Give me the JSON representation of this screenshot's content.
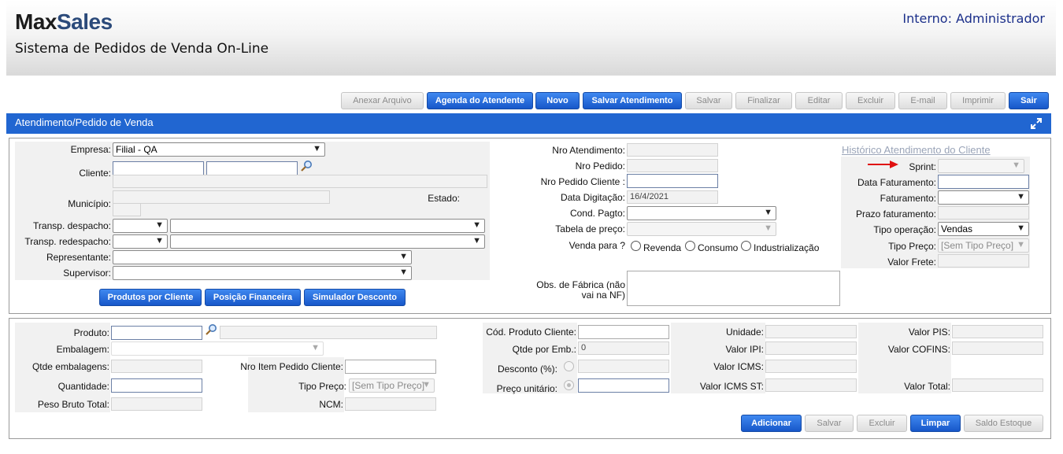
{
  "header": {
    "logo_max": "Max",
    "logo_sales": "Sales",
    "subtitle": "Sistema de Pedidos de Venda On-Line",
    "user": "Interno: Administrador"
  },
  "toolbar": {
    "anexar": "Anexar Arquivo",
    "agenda": "Agenda do Atendente",
    "novo": "Novo",
    "salvar_atendimento": "Salvar Atendimento",
    "salvar": "Salvar",
    "finalizar": "Finalizar",
    "editar": "Editar",
    "excluir": "Excluir",
    "email": "E-mail",
    "imprimir": "Imprimir",
    "sair": "Sair"
  },
  "section": {
    "title": "Atendimento/Pedido de Venda"
  },
  "form": {
    "empresa_label": "Empresa:",
    "empresa_value": "Filial - QA",
    "cliente_label": "Cliente:",
    "municipio_label": "Município:",
    "estado_label": "Estado:",
    "transp_despacho_label": "Transp. despacho:",
    "transp_redespacho_label": "Transp. redespacho:",
    "representante_label": "Representante:",
    "supervisor_label": "Supervisor:",
    "btn_produtos": "Produtos por Cliente",
    "btn_posicao": "Posição Financeira",
    "btn_simulador": "Simulador Desconto",
    "nro_atendimento_label": "Nro Atendimento:",
    "nro_pedido_label": "Nro Pedido:",
    "nro_pedido_cliente_label": "Nro Pedido Cliente :",
    "data_digitacao_label": "Data Digitação:",
    "data_digitacao_value": "16/4/2021",
    "cond_pagto_label": "Cond. Pagto:",
    "tabela_preco_label": "Tabela de preço:",
    "venda_para_label": "Venda para ?",
    "venda_options": [
      "Revenda",
      "Consumo",
      "Industrialização"
    ],
    "obs_label_1": "Obs. de Fábrica (não",
    "obs_label_2": "vai na NF)",
    "historico_link": "Histórico Atendimento do Cliente",
    "sprint_label": "Sprint:",
    "data_faturamento_label": "Data Faturamento:",
    "faturamento_label": "Faturamento:",
    "prazo_faturamento_label": "Prazo faturamento:",
    "tipo_operacao_label": "Tipo operação:",
    "tipo_operacao_value": "Vendas",
    "tipo_preco_label": "Tipo Preço:",
    "tipo_preco_value": "[Sem Tipo Preço]",
    "valor_frete_label": "Valor Frete:"
  },
  "produto": {
    "produto_label": "Produto:",
    "embalagem_label": "Embalagem:",
    "qtde_embalagens_label": "Qtde embalagens:",
    "nro_item_label": "Nro Item Pedido Cliente:",
    "quantidade_label": "Quantidade:",
    "tipo_preco_label": "Tipo Preço:",
    "tipo_preco_value": "[Sem Tipo Preço]",
    "peso_bruto_label": "Peso Bruto Total:",
    "ncm_label": "NCM:",
    "cod_produto_cliente_label": "Cód. Produto Cliente:",
    "qtde_por_emb_label": "Qtde por Emb.:",
    "qtde_por_emb_value": "0",
    "desconto_label": "Desconto (%):",
    "preco_unitario_label": "Preço unitário:",
    "unidade_label": "Unidade:",
    "valor_ipi_label": "Valor IPI:",
    "valor_icms_label": "Valor ICMS:",
    "valor_icms_st_label": "Valor ICMS ST:",
    "valor_pis_label": "Valor PIS:",
    "valor_cofins_label": "Valor COFINS:",
    "valor_total_label": "Valor Total:"
  },
  "bottom_buttons": {
    "adicionar": "Adicionar",
    "salvar": "Salvar",
    "excluir": "Excluir",
    "limpar": "Limpar",
    "saldo": "Saldo Estoque"
  },
  "colors": {
    "accent": "#2166d1",
    "arrow": "#e01010"
  },
  "icons": [
    "search-icon",
    "expand-icon",
    "arrow-icon",
    "chevron-down-icon"
  ]
}
